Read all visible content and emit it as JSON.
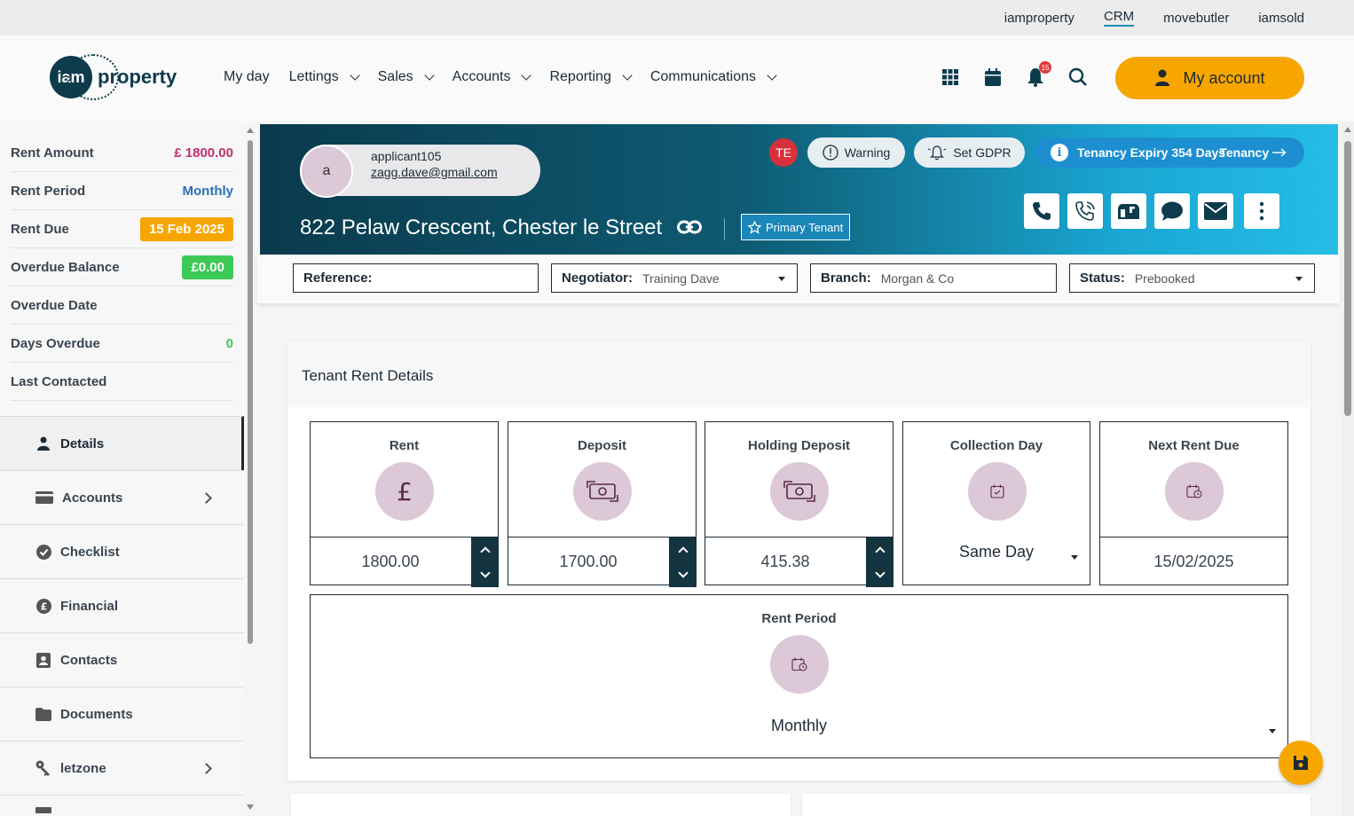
{
  "top_links": {
    "iamproperty": "iamproperty",
    "crm": "CRM",
    "movebutler": "movebutler",
    "iamsold": "iamsold"
  },
  "logo": {
    "iam": "iam",
    "word": "property"
  },
  "nav": {
    "my_day": "My day",
    "lettings": "Lettings",
    "sales": "Sales",
    "accounts": "Accounts",
    "reporting": "Reporting",
    "communications": "Communications"
  },
  "header_icons": {
    "notifications_count": "15",
    "apps": "grid-icon",
    "calendar": "calendar-icon",
    "bell": "bell-icon",
    "search": "search-icon"
  },
  "my_account": "My account",
  "summary": {
    "rent_amount_label": "Rent Amount",
    "rent_amount": "£ 1800.00",
    "rent_period_label": "Rent Period",
    "rent_period": "Monthly",
    "rent_due_label": "Rent Due",
    "rent_due": "15 Feb 2025",
    "overdue_balance_label": "Overdue Balance",
    "overdue_balance": "£0.00",
    "overdue_date_label": "Overdue Date",
    "days_overdue_label": "Days Overdue",
    "days_overdue": "0",
    "last_contacted_label": "Last Contacted"
  },
  "menu": {
    "details": "Details",
    "accounts": "Accounts",
    "checklist": "Checklist",
    "financial": "Financial",
    "contacts": "Contacts",
    "documents": "Documents",
    "letzone": "letzone"
  },
  "applicant": {
    "initial": "a",
    "name": "applicant105",
    "email": "zagg.dave@gmail.com",
    "address": "822 Pelaw Crescent, Chester le Street",
    "primary_tenant": "Primary Tenant",
    "te": "TE",
    "warning": "Warning",
    "gdpr": "Set GDPR",
    "tenancy_expiry": "Tenancy Expiry 354 Days",
    "tenancy_link": "Tenancy"
  },
  "filters": {
    "reference_label": "Reference:",
    "reference_value": "",
    "negotiator_label": "Negotiator:",
    "negotiator_value": "Training Dave",
    "branch_label": "Branch:",
    "branch_value": "Morgan & Co",
    "status_label": "Status:",
    "status_value": "Prebooked"
  },
  "rent_details": {
    "title": "Tenant Rent Details",
    "rent_label": "Rent",
    "rent_value": "1800.00",
    "deposit_label": "Deposit",
    "deposit_value": "1700.00",
    "holding_label": "Holding Deposit",
    "holding_value": "415.38",
    "collection_label": "Collection Day",
    "collection_value": "Same Day",
    "next_due_label": "Next Rent Due",
    "next_due_value": "15/02/2025",
    "rent_period_label": "Rent Period",
    "rent_period_value": "Monthly"
  },
  "colors": {
    "accent": "#f7a600",
    "dark": "#0d3b4c",
    "banner_end": "#25bde6"
  }
}
